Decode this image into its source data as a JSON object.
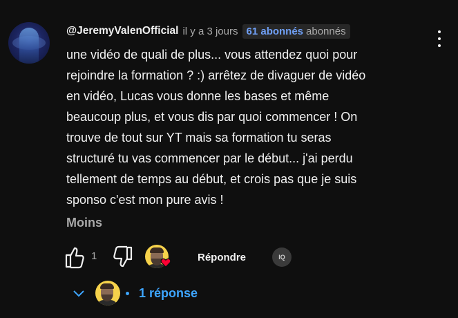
{
  "comment": {
    "author_handle": "@JeremyValenOfficial",
    "timestamp": "il y a 3 jours",
    "subscriber_badge": {
      "count": "61 abonnés",
      "label": "abonnés"
    },
    "text": "une vidéo de quali de plus...  vous attendez quoi pour\nrejoindre la formation ? :) arrêtez de divaguer de vidéo\nen vidéo, Lucas vous donne les bases et même\nbeaucoup plus, et vous dis par quoi commencer ! On\ntrouve de tout sur YT mais sa formation tu seras\nstructuré tu vas commencer par le début... j'ai perdu\ntellement de temps au début, et crois pas que je suis\nsponso c'est mon pure avis !",
    "show_less_label": "Moins"
  },
  "actions": {
    "like_count": "1",
    "reply_label": "Répondre",
    "creator_badge_text": "IQ"
  },
  "replies": {
    "label": "1 réponse"
  },
  "colors": {
    "background": "#0f0f0f",
    "primary_text": "#f1f1f1",
    "secondary_text": "#aaaaaa",
    "accent_blue": "#3ea6ff",
    "badge_count_blue": "#6f9ff5",
    "heart_red": "#ff0033"
  },
  "icons": [
    "author-avatar",
    "thumbs-up-icon",
    "thumbs-down-icon",
    "creator-heart-icon",
    "more-vert-icon",
    "chevron-down-icon",
    "creator-avatar"
  ]
}
